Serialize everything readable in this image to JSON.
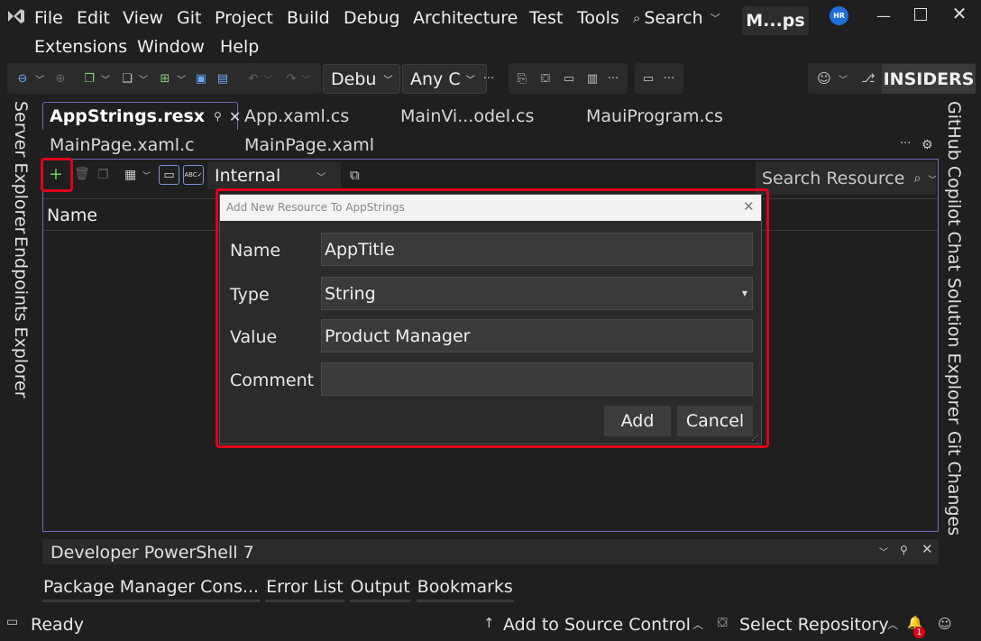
{
  "menu": [
    "File",
    "Edit",
    "View",
    "Git",
    "Project",
    "Build",
    "Debug",
    "Architecture",
    "Test",
    "Tools"
  ],
  "menu2": [
    "Extensions",
    "Window",
    "Help"
  ],
  "search_label": "Search",
  "solution_name": "M...ps",
  "avatar_initials": "HR",
  "toolbar": {
    "config": "Debu",
    "platform": "Any C",
    "insiders": "INSIDERS"
  },
  "tabs_row1": [
    "AppStrings.resx",
    "App.xaml.cs",
    "MainVi...odel.cs",
    "MauiProgram.cs"
  ],
  "tabs_row2": [
    "MainPage.xaml.c",
    "MainPage.xaml"
  ],
  "left_panels": [
    "Server Explorer",
    "Endpoints Explorer"
  ],
  "right_panels": [
    "GitHub Copilot Chat",
    "Solution Explorer",
    "Git Changes"
  ],
  "resx": {
    "access_modifier": "Internal",
    "search_placeholder": "Search Resource",
    "column_name": "Name"
  },
  "dialog": {
    "title": "Add New Resource To AppStrings",
    "name_label": "Name",
    "name_value": "AppTitle",
    "type_label": "Type",
    "type_value": "String",
    "value_label": "Value",
    "value_value": "Product Manager",
    "comment_label": "Comment",
    "comment_value": "",
    "add_label": "Add",
    "cancel_label": "Cancel"
  },
  "bottom_panel": {
    "title": "Developer PowerShell 7",
    "tabs": [
      "Package Manager Cons...",
      "Error List",
      "Output",
      "Bookmarks"
    ]
  },
  "status": {
    "ready": "Ready",
    "source_control": "Add to Source Control",
    "repository": "Select Repository",
    "notifications": "1"
  },
  "colors": {
    "accent_red": "#e0001b",
    "avatar_blue": "#1e6fd9",
    "doc_border": "#6b6bb8"
  }
}
